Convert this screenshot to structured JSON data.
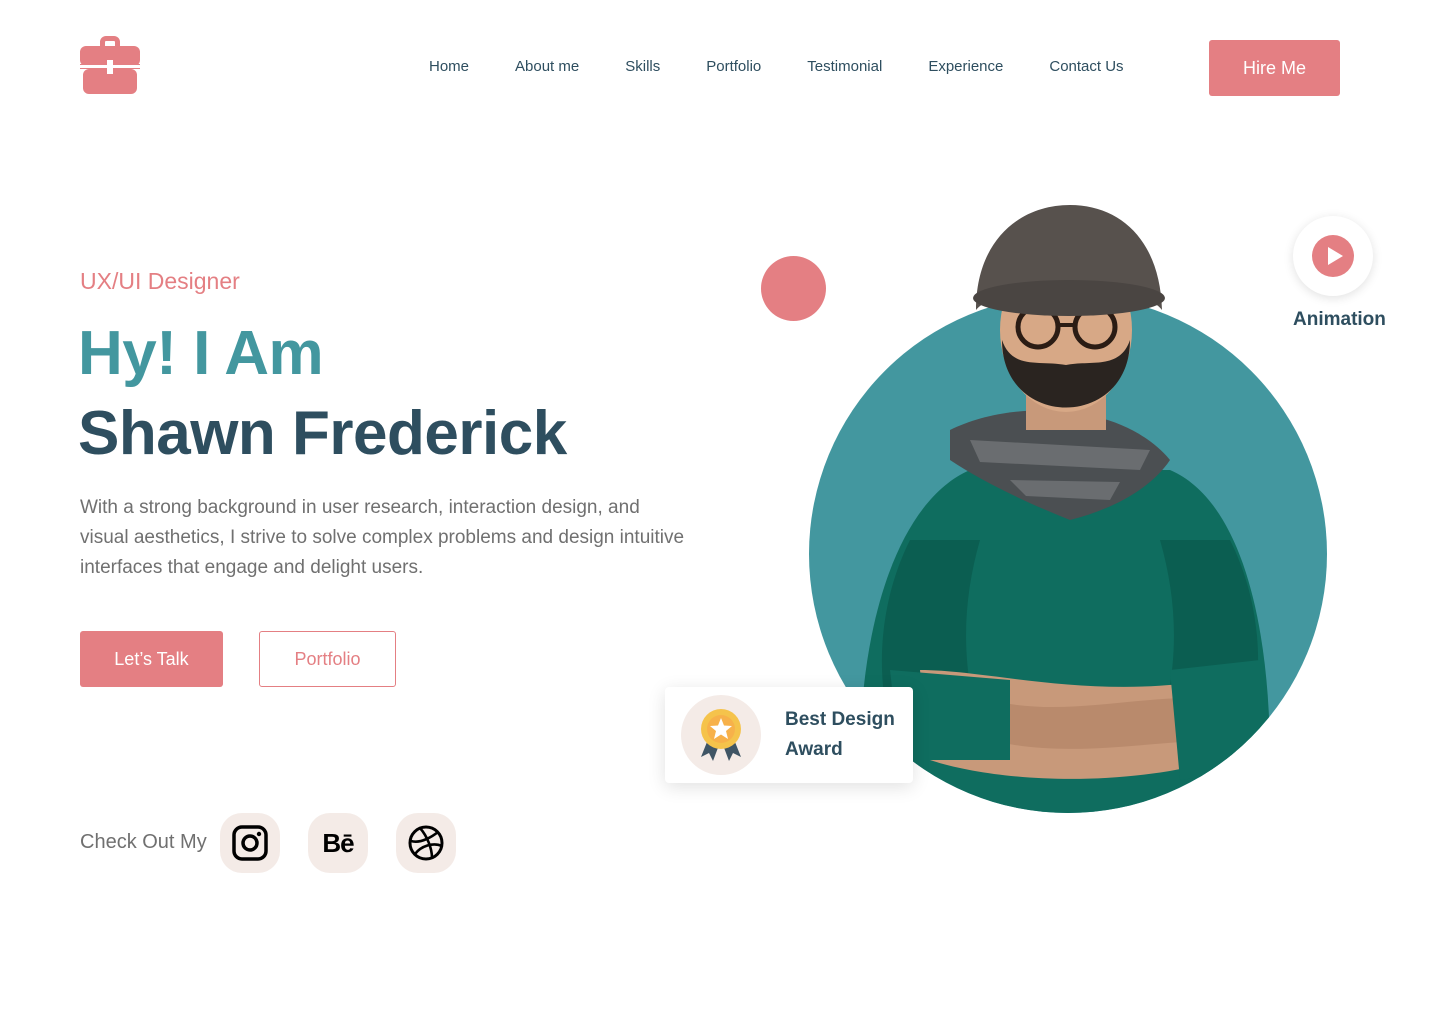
{
  "brand": {
    "logo_icon": "briefcase-icon",
    "accent_color": "#e47f83",
    "teal_color": "#43979f",
    "dark_color": "#2e4e5f"
  },
  "nav": {
    "items": [
      {
        "label": "Home"
      },
      {
        "label": "About me"
      },
      {
        "label": "Skills"
      },
      {
        "label": "Portfolio"
      },
      {
        "label": "Testimonial"
      },
      {
        "label": "Experience"
      },
      {
        "label": "Contact Us"
      }
    ],
    "cta_label": "Hire Me"
  },
  "hero": {
    "role": "UX/UI Designer",
    "greeting": "Hy! I Am",
    "name": "Shawn Frederick",
    "description": "With a strong background in user research, interaction design, and visual aesthetics, I strive to solve complex problems and design intuitive interfaces that engage and delight users.",
    "primary_button": "Let’s Talk",
    "secondary_button": "Portfolio"
  },
  "social": {
    "label": "Check Out My",
    "links": [
      {
        "name": "Instagram",
        "icon": "instagram-icon"
      },
      {
        "name": "Behance",
        "icon": "behance-icon",
        "glyph": "Bē"
      },
      {
        "name": "Dribbble",
        "icon": "dribbble-icon"
      }
    ]
  },
  "badges": {
    "animation_label": "Animation",
    "award_line1": "Best Design",
    "award_line2": "Award"
  }
}
